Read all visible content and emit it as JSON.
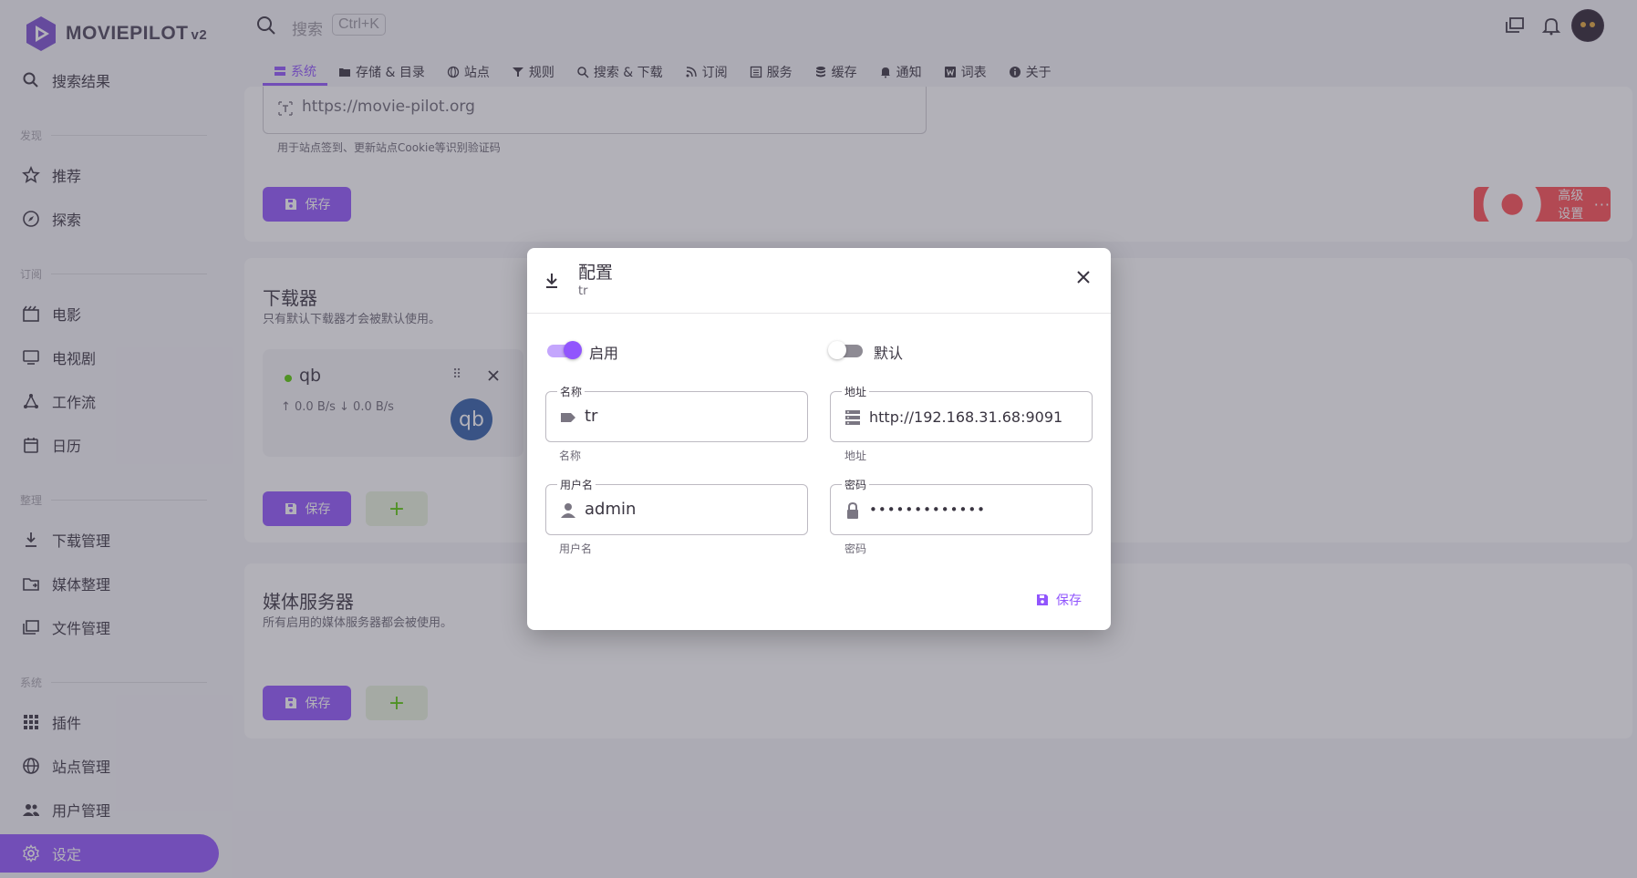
{
  "app": {
    "name": "MOVIEPILOT",
    "version": "v2"
  },
  "search": {
    "placeholder": "搜索",
    "shortcut": "Ctrl+K"
  },
  "sidebar": {
    "items": [
      {
        "label": "搜索结果",
        "icon": "search-icon"
      },
      {
        "label": "推荐",
        "icon": "star-icon"
      },
      {
        "label": "探索",
        "icon": "compass-icon"
      },
      {
        "label": "电影",
        "icon": "movie-icon"
      },
      {
        "label": "电视剧",
        "icon": "tv-icon"
      },
      {
        "label": "工作流",
        "icon": "workflow-icon"
      },
      {
        "label": "日历",
        "icon": "calendar-icon"
      },
      {
        "label": "下载管理",
        "icon": "download-icon"
      },
      {
        "label": "媒体整理",
        "icon": "media-organize-icon"
      },
      {
        "label": "文件管理",
        "icon": "folder-icon"
      },
      {
        "label": "插件",
        "icon": "apps-icon"
      },
      {
        "label": "站点管理",
        "icon": "globe-icon"
      },
      {
        "label": "用户管理",
        "icon": "users-icon"
      },
      {
        "label": "设定",
        "icon": "gear-icon"
      }
    ],
    "sections": [
      "发现",
      "订阅",
      "整理",
      "系统"
    ]
  },
  "tabs": [
    "系统",
    "存储 & 目录",
    "站点",
    "规则",
    "搜索 & 下载",
    "订阅",
    "服务",
    "缓存",
    "通知",
    "词表",
    "关于"
  ],
  "system_card": {
    "url_value": "https://movie-pilot.org",
    "url_hint": "用于站点签到、更新站点Cookie等识别验证码",
    "save_label": "保存",
    "advanced_label": "高级设置"
  },
  "downloader_card": {
    "title": "下载器",
    "subtitle": "只有默认下载器才会被默认使用。",
    "item": {
      "name": "qb",
      "speed": "↑ 0.0 B/s  ↓ 0.0 B/s",
      "logo_text": "qb"
    },
    "save_label": "保存",
    "add_label": "+"
  },
  "media_server_card": {
    "title": "媒体服务器",
    "subtitle": "所有启用的媒体服务器都会被使用。",
    "save_label": "保存",
    "add_label": "+"
  },
  "dialog": {
    "title": "配置",
    "subtitle": "tr",
    "enable_label": "启用",
    "enable_on": true,
    "default_label": "默认",
    "default_on": false,
    "fields": {
      "name": {
        "label": "名称",
        "value": "tr",
        "hint": "名称"
      },
      "host": {
        "label": "地址",
        "value": "http://192.168.31.68:9091",
        "hint": "地址"
      },
      "username": {
        "label": "用户名",
        "value": "admin",
        "hint": "用户名"
      },
      "password": {
        "label": "密码",
        "value": "•••••••••••••",
        "hint": "密码"
      }
    },
    "save_label": "保存"
  },
  "colors": {
    "primary": "#9155fd",
    "danger": "#ff4c51",
    "success": "#56ca00"
  }
}
